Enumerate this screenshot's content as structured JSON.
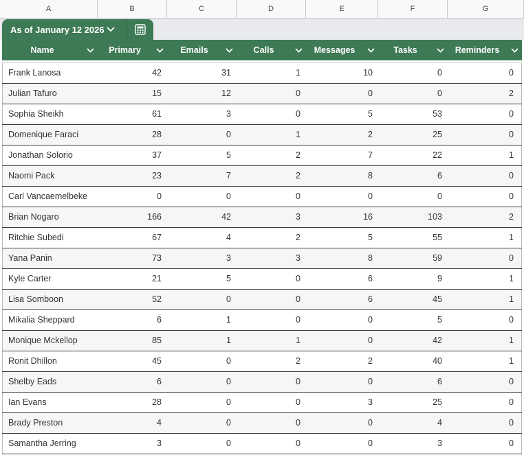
{
  "column_letters": [
    "A",
    "B",
    "C",
    "D",
    "E",
    "F",
    "G"
  ],
  "table": {
    "name": "As of January 12 2026",
    "chevron_icon": "chevron-down-icon",
    "calc_icon": "calculator-icon",
    "accent_color": "#3d7a55"
  },
  "headers": [
    "Name",
    "Primary",
    "Emails",
    "Calls",
    "Messages",
    "Tasks",
    "Reminders"
  ],
  "rows": [
    [
      "Frank Lanosa",
      "42",
      "31",
      "1",
      "10",
      "0",
      "0"
    ],
    [
      "Julian Tafuro",
      "15",
      "12",
      "0",
      "0",
      "0",
      "2"
    ],
    [
      "Sophia Sheikh",
      "61",
      "3",
      "0",
      "5",
      "53",
      "0"
    ],
    [
      "Domenique Faraci",
      "28",
      "0",
      "1",
      "2",
      "25",
      "0"
    ],
    [
      "Jonathan Solorio",
      "37",
      "5",
      "2",
      "7",
      "22",
      "1"
    ],
    [
      "Naomi Pack",
      "23",
      "7",
      "2",
      "8",
      "6",
      "0"
    ],
    [
      "Carl Vancaemelbeke",
      "0",
      "0",
      "0",
      "0",
      "0",
      "0"
    ],
    [
      "Brian Nogaro",
      "166",
      "42",
      "3",
      "16",
      "103",
      "2"
    ],
    [
      "Ritchie Subedi",
      "67",
      "4",
      "2",
      "5",
      "55",
      "1"
    ],
    [
      "Yana Panin",
      "73",
      "3",
      "3",
      "8",
      "59",
      "0"
    ],
    [
      "Kyle Carter",
      "21",
      "5",
      "0",
      "6",
      "9",
      "1"
    ],
    [
      "Lisa Somboon",
      "52",
      "0",
      "0",
      "6",
      "45",
      "1"
    ],
    [
      "Mikalia Sheppard",
      "6",
      "1",
      "0",
      "0",
      "5",
      "0"
    ],
    [
      "Monique Mckellop",
      "85",
      "1",
      "1",
      "0",
      "42",
      "1"
    ],
    [
      "Ronit Dhillon",
      "45",
      "0",
      "2",
      "2",
      "40",
      "1"
    ],
    [
      "Shelby Eads",
      "6",
      "0",
      "0",
      "0",
      "6",
      "0"
    ],
    [
      "Ian Evans",
      "28",
      "0",
      "0",
      "3",
      "25",
      "0"
    ],
    [
      "Brady Preston",
      "4",
      "0",
      "0",
      "0",
      "4",
      "0"
    ],
    [
      "Samantha Jerring",
      "3",
      "0",
      "0",
      "0",
      "3",
      "0"
    ]
  ]
}
